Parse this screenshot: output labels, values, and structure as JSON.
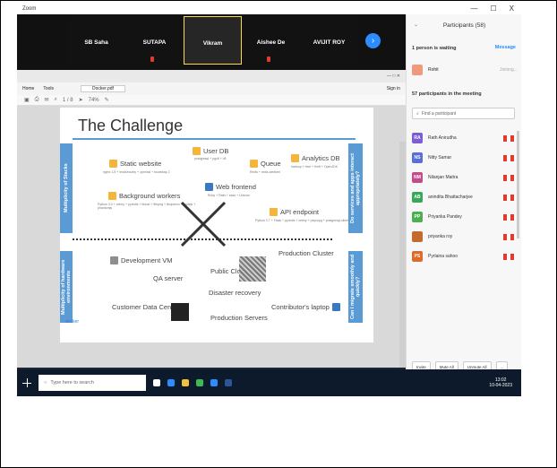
{
  "zoom": {
    "title": "Zoom",
    "window_controls": [
      "—",
      "☐",
      "X"
    ]
  },
  "video_strip": {
    "tiles": [
      {
        "name": "SB Saha",
        "muted": false
      },
      {
        "name": "SUTAPA",
        "muted": true
      },
      {
        "name": "Vikram",
        "muted": false,
        "active": true
      },
      {
        "name": "Aishee De",
        "muted": true
      },
      {
        "name": "AVIJIT ROY",
        "muted": false
      }
    ],
    "next_glyph": "›"
  },
  "shared_window": {
    "title": "— □ ✕",
    "menus": [
      "Home",
      "Tools"
    ],
    "file_tab": "Docker.pdf",
    "sign_in": "Sign in",
    "page_num": "1 / 8",
    "zoom_pct": "74%"
  },
  "slide": {
    "title": "The Challenge",
    "items": [
      {
        "label": "User DB",
        "sub": "postgresql + pgv8 + v8"
      },
      {
        "label": "Static website",
        "sub": "nginx 1.5 + modsecurity + openssl + bootstrap 2"
      },
      {
        "label": "Queue",
        "sub": "Redis + redis-sentinel"
      },
      {
        "label": "Analytics DB",
        "sub": "hadoop + hive + thrift + OpenJDK"
      },
      {
        "label": "Web frontend",
        "sub": "Ruby + Rails + sass + Unicorn"
      },
      {
        "label": "Background workers",
        "sub": "Python 3.0 + celery + pyredis + libcurl + ffmpeg + libopencv + nodejs + phantomjs"
      },
      {
        "label": "API endpoint",
        "sub": "Python 2.7 + Flask + pyredis + celery + psycopg + postgresql-client"
      },
      {
        "label": "Development VM",
        "sub": ""
      },
      {
        "label": "QA server",
        "sub": ""
      },
      {
        "label": "Public Cloud",
        "sub": ""
      },
      {
        "label": "Production Cluster",
        "sub": ""
      },
      {
        "label": "Disaster recovery",
        "sub": ""
      },
      {
        "label": "Customer Data Center",
        "sub": ""
      },
      {
        "label": "Production Servers",
        "sub": ""
      },
      {
        "label": "Contributor's laptop",
        "sub": ""
      }
    ],
    "side_left_top": "Multiplicity of Stacks",
    "side_right_top": "Do services and apps interact appropriately?",
    "side_left_bottom": "Multiplicity of hardware environments",
    "side_right_bottom": "Can I migrate smoothly and quickly?",
    "logo_text": "docker"
  },
  "participants": {
    "title": "Participants (58)",
    "waiting_header": "1 person is waiting",
    "message_all": "Message",
    "waiting": [
      {
        "name": "Rohit",
        "status": "Joining..."
      }
    ],
    "in_meeting_header": "57 participants in the meeting",
    "search_placeholder": "Find a participant",
    "list": [
      {
        "initials": "RA",
        "name": "Rath Anirudha",
        "color": "#7b5ed6"
      },
      {
        "initials": "NS",
        "name": "Nitty Samar",
        "color": "#5a6fd6"
      },
      {
        "initials": "NM",
        "name": "Nilanjan Maitra",
        "color": "#c24d8a"
      },
      {
        "initials": "AB",
        "name": "anindita Bhattacharjee",
        "color": "#3aa65c"
      },
      {
        "initials": "PP",
        "name": "Priyanka Pandey",
        "color": "#4caf50"
      },
      {
        "initials": "",
        "name": "priyanka roy",
        "color": "#c46a2d"
      },
      {
        "initials": "PS",
        "name": "Pyrlaina sahoo",
        "color": "#e06a2a"
      }
    ],
    "buttons": [
      "Invite",
      "Mute All",
      "Unmute All",
      "..."
    ]
  },
  "taskbar": {
    "search_placeholder": "Type here to search",
    "time": "13:02",
    "date": "10-04-2023"
  }
}
